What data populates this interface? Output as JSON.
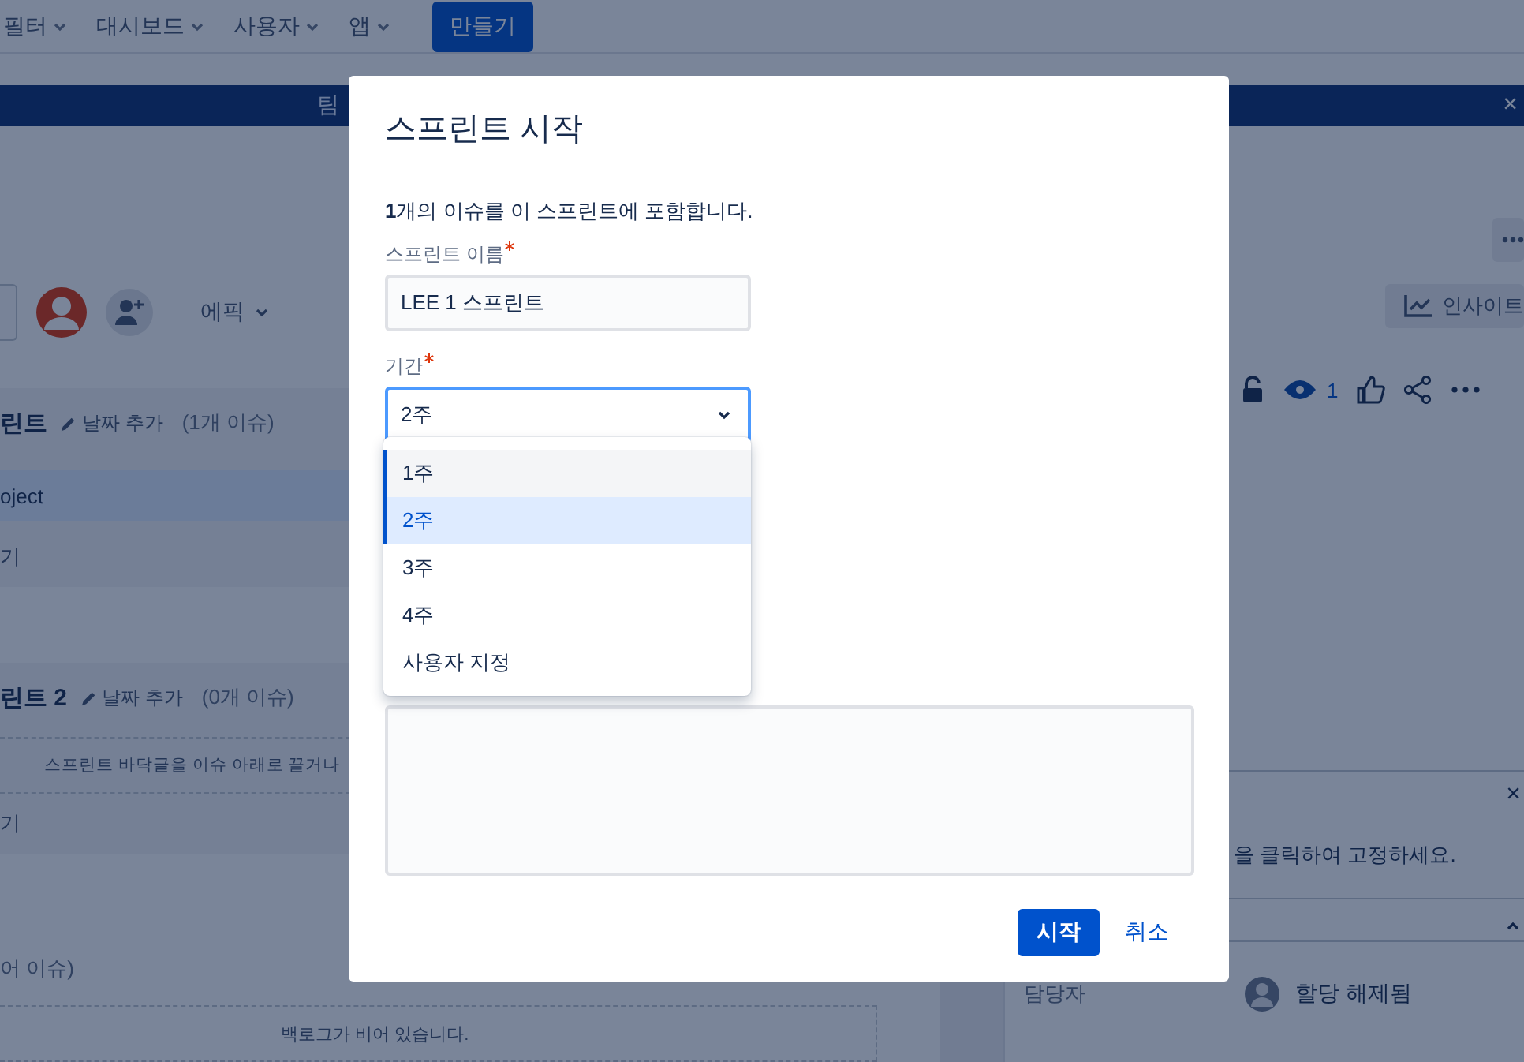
{
  "top_nav": {
    "menus": [
      {
        "label": "필터"
      },
      {
        "label": "대시보드"
      },
      {
        "label": "사용자"
      },
      {
        "label": "앱"
      }
    ],
    "create_button": "만들기"
  },
  "banner": {
    "text": "팀",
    "close": "×"
  },
  "board": {
    "epic_filter": "에픽",
    "sprints": [
      {
        "name": "린트",
        "add_date": "날짜 추가",
        "count": "(1개 이슈)",
        "issues": [
          {
            "summary": "oject"
          }
        ],
        "create": "기"
      },
      {
        "name": "린트 2",
        "add_date": "날짜 추가",
        "count": "(0개 이슈)",
        "empty_hint": "스프린트 바닥글을 이슈 아래로 끌거나",
        "create": "기"
      }
    ],
    "backlog": {
      "count": "어 이슈)",
      "empty": "백로그가 비어 있습니다."
    }
  },
  "details_panel": {
    "insights": "인사이트",
    "watchers": "1",
    "pin_hint": "을 클릭하여 고정하세요.",
    "close": "×",
    "assignee_label": "담당자",
    "assignee": "할당 해제됨"
  },
  "dialog": {
    "title": "스프린트 시작",
    "intro": "**1**개의 이슈를 이 스프린트에 포함합니다.",
    "fields": [
      {
        "kind": "text",
        "label": "스프린트 이름",
        "required": true,
        "value": "LEE 1 스프린트"
      },
      {
        "kind": "select",
        "label": "기간",
        "required": true,
        "value": "2주",
        "open": true
      }
    ],
    "duration_options": [
      {
        "label": "1주",
        "selected": false,
        "hovered": true
      },
      {
        "label": "2주",
        "selected": true,
        "hovered": false
      },
      {
        "label": "3주",
        "selected": false,
        "hovered": false
      },
      {
        "label": "4주",
        "selected": false,
        "hovered": false
      },
      {
        "label": "사용자 지정",
        "selected": false,
        "hovered": false
      }
    ],
    "buttons": [
      {
        "kind": "primary",
        "label": "시작"
      },
      {
        "kind": "link",
        "label": "취소"
      }
    ]
  }
}
